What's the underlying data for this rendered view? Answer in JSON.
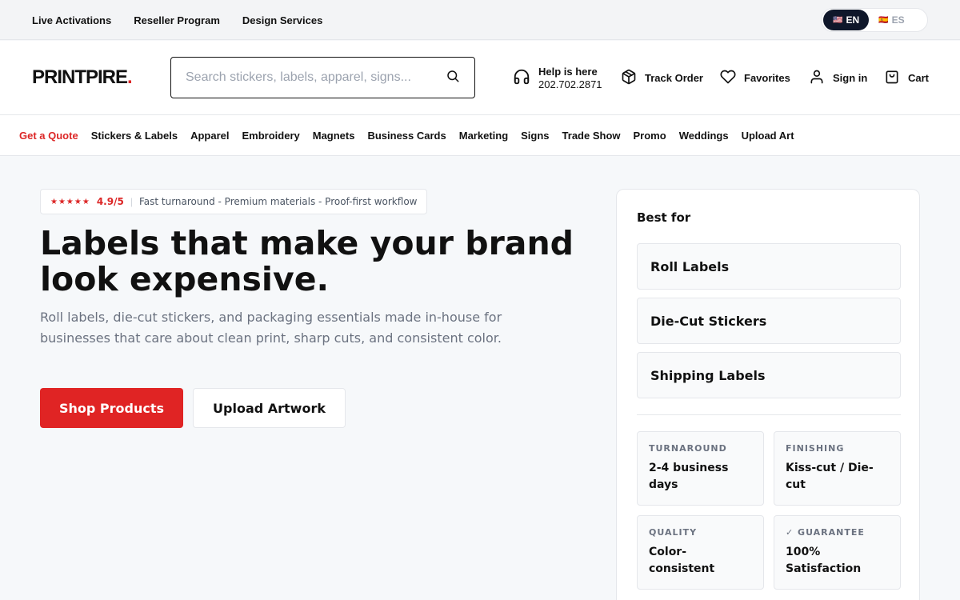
{
  "topbar": {
    "links": [
      "Live Activations",
      "Reseller Program",
      "Design Services"
    ],
    "languages": [
      {
        "flag": "🇺🇸",
        "code": "EN",
        "active": true
      },
      {
        "flag": "🇪🇸",
        "code": "ES",
        "active": false
      }
    ]
  },
  "header": {
    "logo_text": "PRINTPIRE",
    "logo_dot": ".",
    "search_placeholder": "Search stickers, labels, apparel, signs...",
    "help_title": "Help is here",
    "help_phone": "202.702.2871",
    "track_order": "Track Order",
    "favorites": "Favorites",
    "sign_in": "Sign in",
    "cart": "Cart"
  },
  "nav": {
    "quote": "Get a Quote",
    "items": [
      "Stickers & Labels",
      "Apparel",
      "Embroidery",
      "Magnets",
      "Business Cards",
      "Marketing",
      "Signs",
      "Trade Show",
      "Promo",
      "Weddings",
      "Upload Art"
    ]
  },
  "hero": {
    "stars": "★★★★★",
    "rating": "4.9/5",
    "separator": "|",
    "features": "Fast turnaround - Premium materials - Proof-first workflow",
    "headline": "Labels that make your brand look expensive.",
    "subcopy": "Roll labels, die-cut stickers, and packaging essentials made in-house for businesses that care about clean print, sharp cuts, and consistent color.",
    "primary_button": "Shop Products",
    "secondary_button": "Upload Artwork"
  },
  "panel": {
    "title": "Best for",
    "best_for": [
      "Roll Labels",
      "Die-Cut Stickers",
      "Shipping Labels"
    ],
    "specs": [
      {
        "label": "TURNAROUND",
        "value": "2-4 business days"
      },
      {
        "label": "FINISHING",
        "value": "Kiss-cut / Die-cut"
      },
      {
        "label": "QUALITY",
        "value": "Color-consistent"
      },
      {
        "label": "✓ GUARANTEE",
        "value": "100% Satisfaction"
      }
    ]
  },
  "colors": {
    "accent": "#e02424",
    "text": "#111111",
    "muted": "#6b7280",
    "dark_pill": "#0f172a"
  }
}
